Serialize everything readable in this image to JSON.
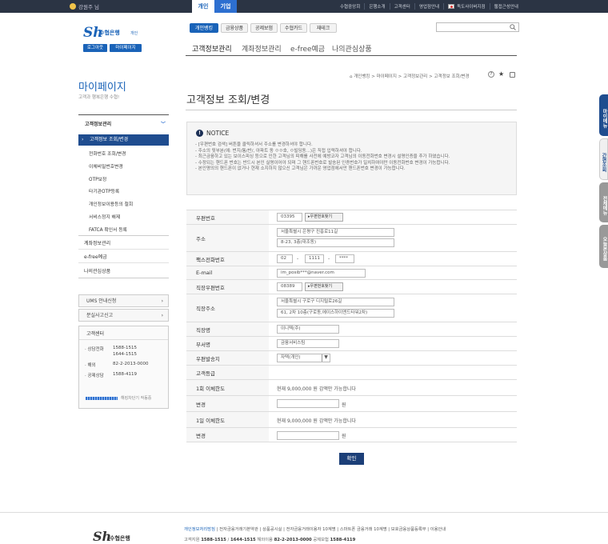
{
  "header": {
    "user_greeting": "강원주 님",
    "tab_personal": "개인",
    "tab_business": "기업",
    "links": [
      "수협중앙회",
      "은행소개",
      "고객센터",
      "영업점안내",
      "독도사이버지점",
      "웹접근성안내"
    ],
    "colors": {
      "topbar": "#2b3444",
      "personal_tab": "#ffffff",
      "business_tab": "#2d6fd0",
      "brand": "#1a63b8"
    }
  },
  "brand": {
    "logo_mark": "Sh",
    "logo_name": "수협은행",
    "logo_sub": "개인",
    "logout": "로그아웃",
    "mypage": "마이페이지"
  },
  "categories": [
    "개인뱅킹",
    "금융상품",
    "공제보험",
    "수협카드",
    "재테크"
  ],
  "gnb": [
    "고객정보관리",
    "계좌정보관리",
    "e-free예금",
    "나의관심상품"
  ],
  "sidebar": {
    "title": "마이페이지",
    "desc": "고객과 행복은행 수협!",
    "section": "고객정보관리",
    "active": "고객정보 조회/변경",
    "sub_items": [
      "전화번호 조회/변경",
      "이체비밀번호변경",
      "OTP보정",
      "타기관OTP등록",
      "개인정보이용등의 철회",
      "서비스정지 해제",
      "FATCA 확인서 등록"
    ],
    "items": [
      "계좌정보관리",
      "e-free예금",
      "나의관심상품"
    ],
    "quick": [
      "UMS 안내신청",
      "분실사고신고"
    ],
    "center_title": "고객센터",
    "center_lines": [
      {
        "label": "· 상담전화",
        "value": "1588-1515"
      },
      {
        "label": "",
        "value": "1644-1515"
      },
      {
        "label": "· 해외",
        "value": "82-2-2013-0000"
      },
      {
        "label": "· 공제상담",
        "value": "1588-4119"
      }
    ],
    "status_text": "해킹차단기 작동중"
  },
  "breadcrumb": "개인뱅킹 > 마이페이지 > 고객정보관리 > 고객정보 조회/변경",
  "page": {
    "title": "고객정보 조회/변경"
  },
  "notice": {
    "title": "NOTICE",
    "items": [
      "- [우편번호 검색] 버튼을 클릭하셔서 주소를 변경하셔야 합니다.",
      "- 주소의 뒷부분(예: 번지/통/반/, 아파트 동 ㅇㅇ호, ㅇ빌딩동...)은 직접 입력하셔야 합니다.",
      "- 최근금융하고 있는 보이스피싱 등으로 인한 고객님의 피해를 사전에 예방코자 고객님의 이동전화번호 변경시 설명인증을 추가 하였습니다.",
      "- 수정되는 핸드폰 번호는 반드시 본인 실명이어야 되며 그 핸드폰번호로 발송된 인증번호가 일치하여야만 이동전화번호 변경이 가능합니다.",
      "- 본인명의의 핸드폰이 없거나 현재 소지하지 않으신 고객님은 가까운 영업점에서만 핸드폰번호 변경이 가능합니다."
    ]
  },
  "form": {
    "zip_label": "우편번호",
    "zip_value": "03395",
    "zip_btn": "우편번호찾기",
    "addr_label": "주소",
    "addr1": "서울특별시 은평구 진흥로11길",
    "addr2": "8-23, 3층(대조동)",
    "fax_label": "팩스전화번호",
    "fax1": "02",
    "fax2": "1111",
    "fax3": "****",
    "dash": "-",
    "email_label": "E-mail",
    "email": "im_posib***@naver.com",
    "work_zip_label": "직장우편번호",
    "work_zip": "08389",
    "work_zip_btn": "우편번호찾기",
    "work_addr_label": "직장주소",
    "work_addr1": "서울특별시 구로구 디지털로26길",
    "work_addr2": "61, 2차 10층(구로동,에이스하이엔드타워2차)",
    "company_label": "직장명",
    "company": "이니텍(주)",
    "dept_label": "부서명",
    "dept": "금융서비스팀",
    "mail_label": "우편발송지",
    "mail": "자택(개인)",
    "grade_label": "고객등급",
    "once_label": "1회 이체한도",
    "once_text": "현재 9,000,000 원 감액만 가능합니다",
    "change_label": "변경",
    "won": "원",
    "daily_label": "1일 이체한도",
    "daily_text": "현재 9,000,000 원 감액만 가능합니다",
    "confirm": "확인"
  },
  "right_tabs": [
    "마이메뉴",
    "간편조회",
    "전체메뉴",
    "오늘본상품"
  ],
  "footer": {
    "logo_mark": "Sh",
    "logo_name": "수협은행",
    "links": [
      "개인정보처리방침",
      "전자금융거래기본약관",
      "상품공시실",
      "전자금융거래이용자 10계명",
      "스마트폰 금융거래 10계명",
      "보호금융상품등록부",
      "이용안내"
    ],
    "contacts_label": "고객지원",
    "tel1": "1588-1515",
    "tel2": "1644-1515",
    "overseas_label": "해외이용",
    "overseas": "82-2-2013-0000",
    "insure_label": "공제보험",
    "insure": "1588-4119"
  }
}
